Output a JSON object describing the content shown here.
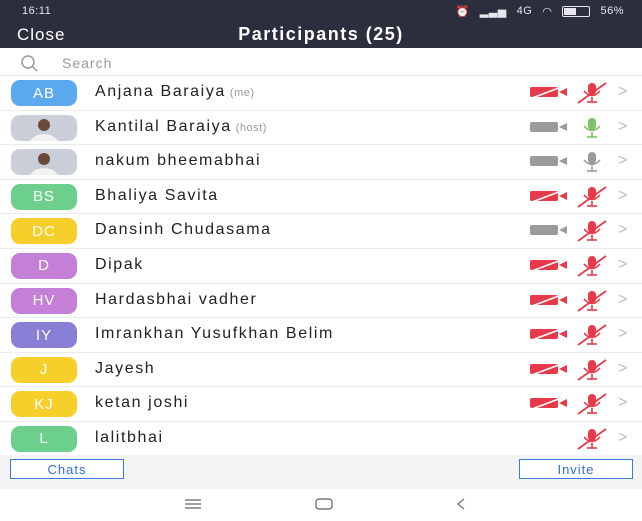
{
  "status_bar": {
    "time": "16:11",
    "network": "4G",
    "battery": "56%"
  },
  "header": {
    "close_label": "Close",
    "title": "Participants (25)"
  },
  "search": {
    "placeholder": "Search"
  },
  "participants": [
    {
      "initials": "AB",
      "avatar_color": "#5aa9ee",
      "name": "Anjana Baraiya",
      "role": "(me)",
      "video": "off",
      "audio": "muted"
    },
    {
      "initials": "",
      "avatar_color": "#d7dbe3",
      "photo": true,
      "name": "Kantilal Baraiya",
      "role": "(host)",
      "video": "on",
      "audio": "on"
    },
    {
      "initials": "",
      "avatar_color": "#d7dbe3",
      "photo": true,
      "name": "nakum bheemabhai",
      "role": "",
      "video": "on",
      "audio": "idle"
    },
    {
      "initials": "BS",
      "avatar_color": "#6ccf8c",
      "name": "Bhaliya Savita",
      "role": "",
      "video": "off",
      "audio": "muted"
    },
    {
      "initials": "DC",
      "avatar_color": "#f7cf2a",
      "name": "Dansinh Chudasama",
      "role": "",
      "video": "on",
      "audio": "muted"
    },
    {
      "initials": "D",
      "avatar_color": "#c47fd6",
      "name": "Dipak",
      "role": "",
      "video": "off",
      "audio": "muted"
    },
    {
      "initials": "HV",
      "avatar_color": "#c47fd6",
      "name": "Hardasbhai vadher",
      "role": "",
      "video": "off",
      "audio": "muted"
    },
    {
      "initials": "IY",
      "avatar_color": "#8a7fd6",
      "name": "Imrankhan Yusufkhan Belim",
      "role": "",
      "video": "off",
      "audio": "muted"
    },
    {
      "initials": "J",
      "avatar_color": "#f7cf2a",
      "name": "Jayesh",
      "role": "",
      "video": "off",
      "audio": "muted"
    },
    {
      "initials": "KJ",
      "avatar_color": "#f7cf2a",
      "name": "ketan joshi",
      "role": "",
      "video": "off",
      "audio": "muted"
    },
    {
      "initials": "L",
      "avatar_color": "#6ccf8c",
      "name": "lalitbhai",
      "role": "",
      "video": "none",
      "audio": "muted"
    }
  ],
  "footer": {
    "chats_label": "Chats",
    "invite_label": "Invite"
  },
  "colors": {
    "header_bg": "#2b2e3d",
    "muted_red": "#e8394a",
    "accent_blue": "#2f6fd6"
  }
}
